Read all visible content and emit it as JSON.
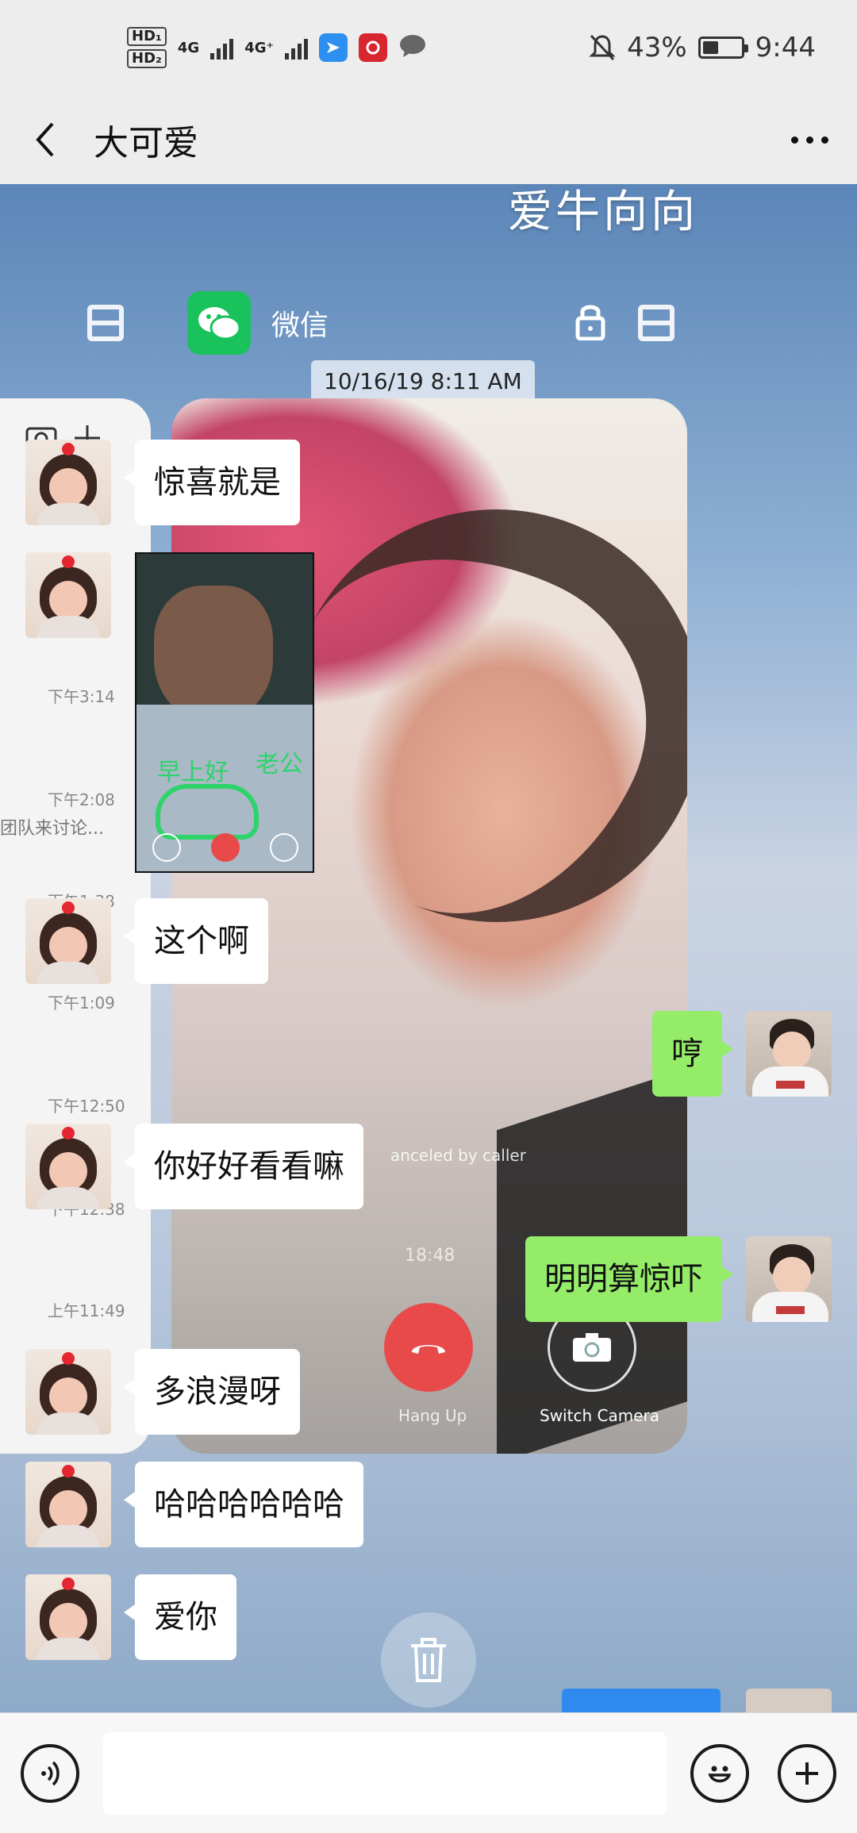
{
  "status_bar": {
    "hd1": "HD₁",
    "hd2": "HD₂",
    "net1": "4G",
    "net2": "4G⁺",
    "battery_text": "43%",
    "battery_level": 0.43,
    "time": "9:44"
  },
  "nav": {
    "title": "大可爱"
  },
  "background_screenshot": {
    "handwriting": "爱牛向向",
    "app_label": "微信",
    "date_chip": "10/16/19 8:11 AM",
    "call_status": "anceled by caller",
    "call_time": "18:48",
    "hangup_label": "Hang Up",
    "switch_camera_label": "Switch Camera",
    "times": [
      "下午3:14",
      "下午2:08",
      "下午1:38",
      "下午1:09",
      "下午12:50",
      "下午12:38",
      "上午11:49"
    ],
    "snippet": "团队来讨论...",
    "pip_text_1": "早上好",
    "pip_text_2": "老公"
  },
  "messages": [
    {
      "side": "left",
      "text": "惊喜就是"
    },
    {
      "side": "left",
      "type": "image"
    },
    {
      "side": "left",
      "text": "这个啊"
    },
    {
      "side": "right",
      "text": "哼"
    },
    {
      "side": "left",
      "text": "你好好看看嘛"
    },
    {
      "side": "right",
      "text": "明明算惊吓"
    },
    {
      "side": "left",
      "text": "多浪漫呀"
    },
    {
      "side": "left",
      "text": "哈哈哈哈哈哈"
    },
    {
      "side": "left",
      "text": "爱你"
    }
  ],
  "input_bar": {
    "placeholder": "",
    "voice_icon": "voice-icon",
    "emoji_icon": "emoji-icon",
    "plus_icon": "plus-icon"
  },
  "colors": {
    "outgoing_bubble": "#95ec69",
    "incoming_bubble": "#ffffff",
    "bar_background": "#ededed",
    "wechat_green": "#19c25b",
    "hangup_red": "#e84a4a"
  }
}
